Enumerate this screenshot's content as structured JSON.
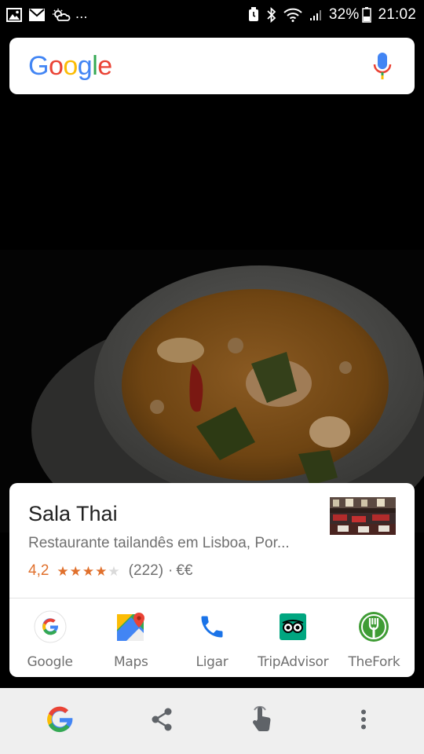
{
  "status_bar": {
    "left_icons": [
      "image-icon",
      "mail-icon",
      "weather-icon"
    ],
    "overflow": "...",
    "battery": "32%",
    "time": "21:02"
  },
  "search": {
    "logo_text": "Google",
    "mic": "mic-icon"
  },
  "card": {
    "title": "Sala Thai",
    "subtitle": "Restaurante tailandês em Lisboa, Por...",
    "rating": "4,2",
    "stars_filled": 4,
    "stars_total": 5,
    "reviews": "(222)",
    "separator": "·",
    "price": "€€",
    "actions": [
      {
        "label": "Google",
        "icon": "google-icon"
      },
      {
        "label": "Maps",
        "icon": "maps-icon"
      },
      {
        "label": "Ligar",
        "icon": "phone-icon"
      },
      {
        "label": "TripAdvisor",
        "icon": "tripadvisor-icon"
      },
      {
        "label": "TheFork",
        "icon": "thefork-icon"
      }
    ]
  },
  "bottom_bar": [
    "google-icon",
    "share-icon",
    "touch-icon",
    "more-icon"
  ],
  "colors": {
    "rating": "#e0702c",
    "google_blue": "#4285F4",
    "google_red": "#EA4335",
    "google_yellow": "#FBBC05",
    "google_green": "#34A853",
    "tripadvisor": "#00A680",
    "thefork": "#3F9C35"
  }
}
